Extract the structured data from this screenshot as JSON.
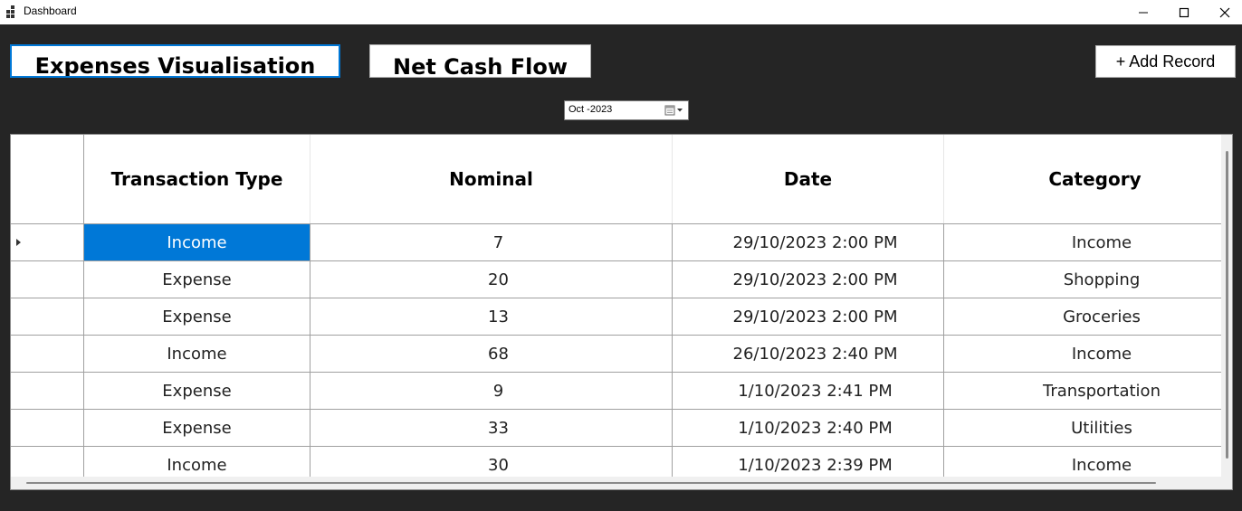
{
  "window": {
    "title": "Dashboard",
    "icon": "app-grid-icon",
    "controls": [
      "minimize-icon",
      "maximize-icon",
      "close-icon"
    ]
  },
  "toolbar": {
    "expenses_tab": "Expenses Visualisation",
    "netflow_tab": "Net Cash Flow",
    "add_record": "+ Add Record"
  },
  "date_picker": {
    "value": "Oct -2023",
    "icon": "calendar-dropdown-icon"
  },
  "grid": {
    "columns": [
      "Transaction Type",
      "Nominal",
      "Date",
      "Category"
    ],
    "selected_row": 0,
    "rows": [
      {
        "type": "Income",
        "nominal": "7",
        "date": "29/10/2023 2:00 PM",
        "category": "Income"
      },
      {
        "type": "Expense",
        "nominal": "20",
        "date": "29/10/2023 2:00 PM",
        "category": "Shopping"
      },
      {
        "type": "Expense",
        "nominal": "13",
        "date": "29/10/2023 2:00 PM",
        "category": "Groceries"
      },
      {
        "type": "Income",
        "nominal": "68",
        "date": "26/10/2023 2:40 PM",
        "category": "Income"
      },
      {
        "type": "Expense",
        "nominal": "9",
        "date": "1/10/2023 2:41 PM",
        "category": "Transportation"
      },
      {
        "type": "Expense",
        "nominal": "33",
        "date": "1/10/2023 2:40 PM",
        "category": "Utilities"
      },
      {
        "type": "Income",
        "nominal": "30",
        "date": "1/10/2023 2:39 PM",
        "category": "Income"
      }
    ]
  },
  "colors": {
    "background": "#252525",
    "selection": "#0078d7",
    "focus_border": "#0078d7"
  }
}
